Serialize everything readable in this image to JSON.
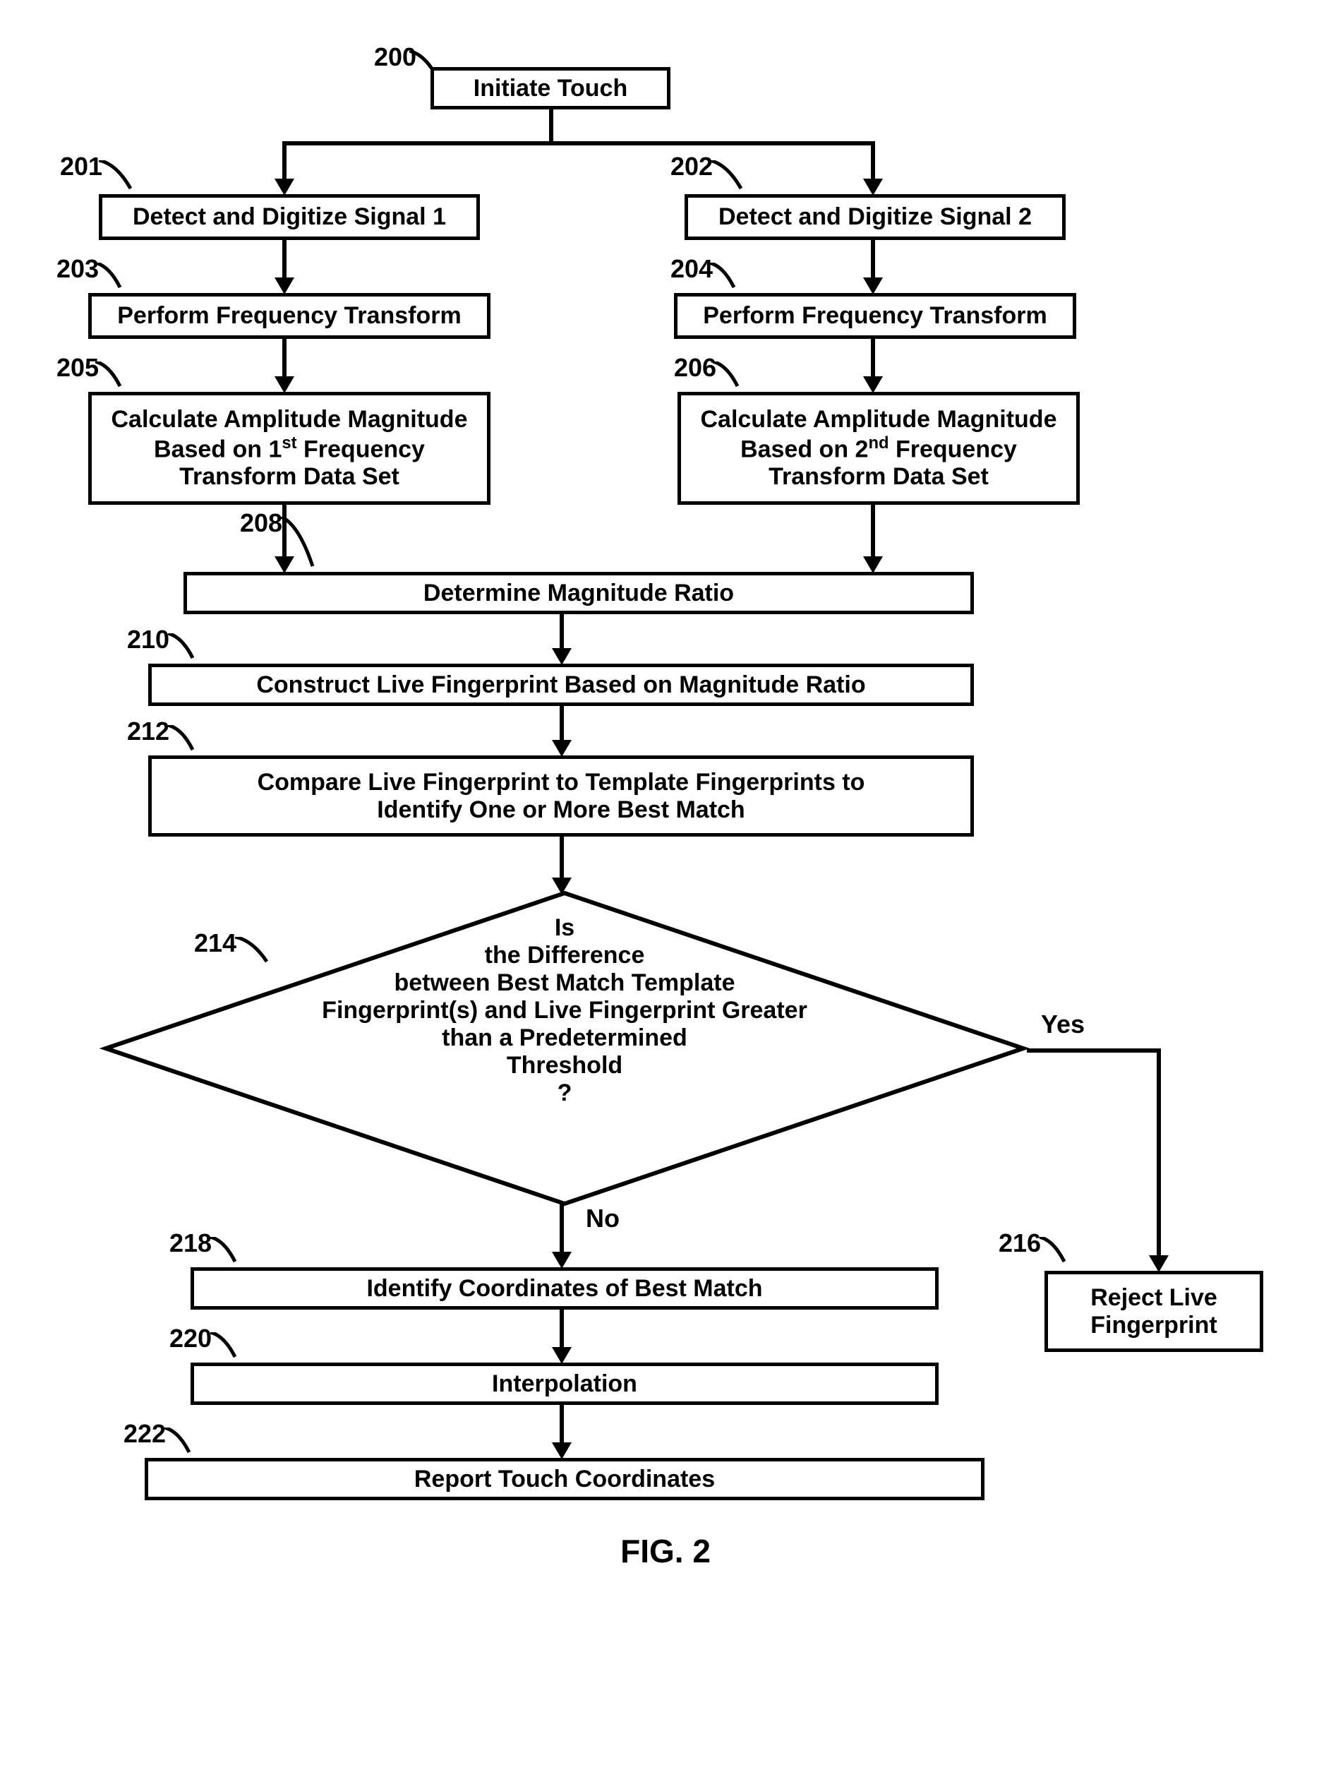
{
  "boxes": {
    "box200": "Initiate Touch",
    "box201": "Detect and Digitize Signal 1",
    "box202": "Detect and Digitize Signal 2",
    "box203": "Perform Frequency Transform",
    "box204": "Perform Frequency Transform",
    "box205_line1": "Calculate Amplitude Magnitude",
    "box205_line2_pre": "Based on 1",
    "box205_line2_sup": "st",
    "box205_line2_post": " Frequency",
    "box205_line3": "Transform Data Set",
    "box206_line1": "Calculate Amplitude Magnitude",
    "box206_line2_pre": "Based on 2",
    "box206_line2_sup": "nd",
    "box206_line2_post": " Frequency",
    "box206_line3": "Transform Data Set",
    "box208": "Determine Magnitude Ratio",
    "box210": "Construct Live Fingerprint Based on Magnitude Ratio",
    "box212_line1": "Compare Live Fingerprint to Template Fingerprints to",
    "box212_line2": "Identify One or More Best Match",
    "decision214_line1": "Is",
    "decision214_line2": "the Difference",
    "decision214_line3": "between Best Match Template",
    "decision214_line4": "Fingerprint(s) and Live Fingerprint Greater",
    "decision214_line5": "than a Predetermined",
    "decision214_line6": "Threshold",
    "decision214_line7": "?",
    "box216_line1": "Reject Live",
    "box216_line2": "Fingerprint",
    "box218": "Identify Coordinates of Best Match",
    "box220": "Interpolation",
    "box222": "Report Touch Coordinates"
  },
  "labels": {
    "l200": "200",
    "l201": "201",
    "l202": "202",
    "l203": "203",
    "l204": "204",
    "l205": "205",
    "l206": "206",
    "l208": "208",
    "l210": "210",
    "l212": "212",
    "l214": "214",
    "l216": "216",
    "l218": "218",
    "l220": "220",
    "l222": "222"
  },
  "branches": {
    "yes": "Yes",
    "no": "No"
  },
  "figure_title": "FIG. 2"
}
